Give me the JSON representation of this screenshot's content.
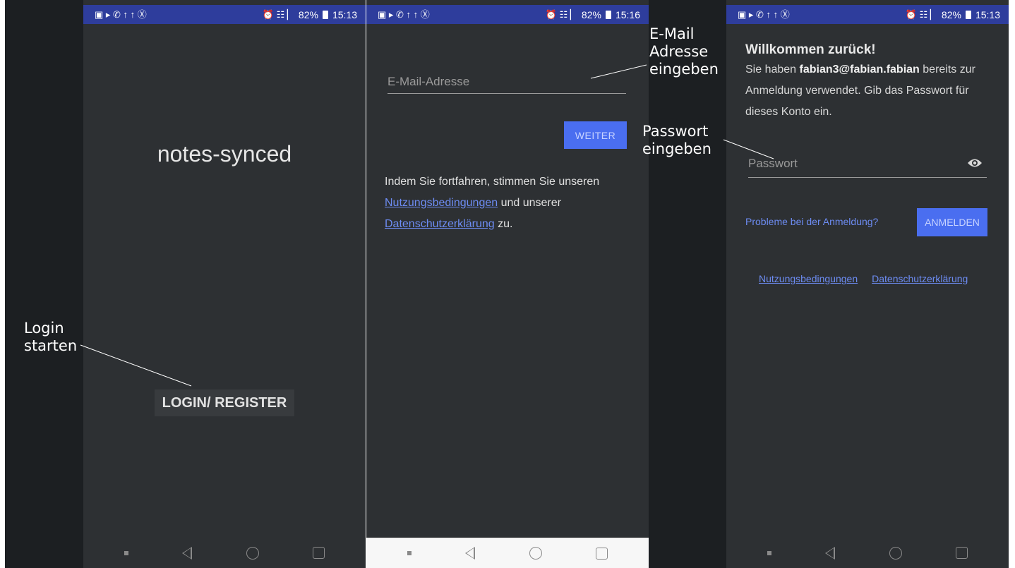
{
  "status_bar": {
    "left_icons": "▣ ▸ ✆ ↑ ↑ Ⓧ",
    "right_icons": "⏰ ☷ ▏",
    "battery": "82%"
  },
  "screen1": {
    "time": "15:13",
    "app_title": "notes-synced",
    "login_button": "LOGIN/ REGISTER"
  },
  "screen2": {
    "time": "15:16",
    "email_placeholder": "E-Mail-Adresse",
    "weiter_button": "WEITER",
    "terms_prefix": "Indem Sie fortfahren, stimmen Sie unseren",
    "terms_link1": "Nutzungsbedingungen",
    "terms_mid": "und unserer",
    "terms_link2": "Datenschutzerklärung",
    "terms_suffix": "zu."
  },
  "screen3": {
    "time": "15:13",
    "welcome_title": "Willkommen zurück!",
    "text_prefix": "Sie haben",
    "email": "fabian3@fabian.fabian",
    "text_suffix": "bereits zur Anmeldung verwendet. Gib das Passwort für dieses Konto ein.",
    "password_placeholder": "Passwort",
    "problem_link": "Probleme bei der Anmeldung?",
    "anmelden_button": "ANMELDEN",
    "footer_link1": "Nutzungsbedingungen",
    "footer_link2": "Datenschutzerklärung"
  },
  "annotations": {
    "login_line1": "Login",
    "login_line2": "starten",
    "email_line1": "E-Mail",
    "email_line2": "Adresse",
    "email_line3": "eingeben",
    "pw_line1": "Passwort",
    "pw_line2": "eingeben"
  }
}
